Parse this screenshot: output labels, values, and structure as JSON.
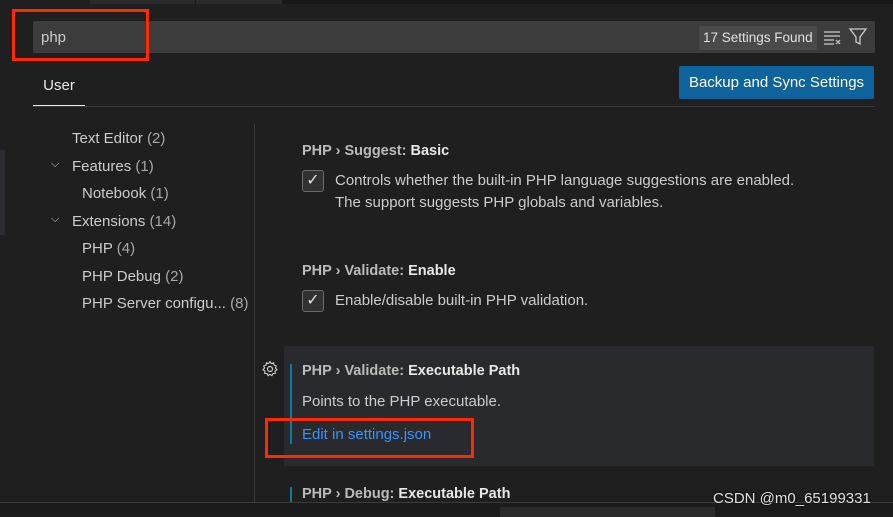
{
  "search": {
    "value": "php",
    "result_count": "17 Settings Found"
  },
  "icons": {
    "clear": "clear-filter-icon",
    "filter": "filter-icon",
    "gear": "gear-icon",
    "check": "checkmark-icon",
    "chevron": "chevron-down-icon"
  },
  "tabs": [
    {
      "label": "User",
      "active": true
    }
  ],
  "sync_button": "Backup and Sync Settings",
  "toc": [
    {
      "label": "Text Editor",
      "count": "(2)"
    },
    {
      "label": "Features",
      "count": "(1)",
      "expanded": true
    },
    {
      "label": "Notebook",
      "count": "(1)"
    },
    {
      "label": "Extensions",
      "count": "(14)",
      "expanded": true
    },
    {
      "label": "PHP",
      "count": "(4)"
    },
    {
      "label": "PHP Debug",
      "count": "(2)"
    },
    {
      "label": "PHP Server configu...",
      "count": "(8)"
    }
  ],
  "settings": [
    {
      "category": "PHP › Suggest: ",
      "name": "Basic",
      "description": "Controls whether the built-in PHP language suggestions are enabled. The support suggests PHP globals and variables.",
      "desc_line1": "Controls whether the built-in PHP language suggestions are enabled.",
      "desc_line2": "The support suggests PHP globals and variables.",
      "checked": true
    },
    {
      "category": "PHP › Validate: ",
      "name": "Enable",
      "description": "Enable/disable built-in PHP validation.",
      "checked": true
    },
    {
      "category": "PHP › Validate: ",
      "name": "Executable Path",
      "description": "Points to the PHP executable.",
      "link": "Edit in settings.json"
    },
    {
      "category": "PHP › Debug: ",
      "name": "Executable Path"
    }
  ],
  "watermark": "CSDN @m0_65199331",
  "colors": {
    "accent": "#0e639c",
    "link": "#3794ff",
    "highlight_box": "#ff2a00",
    "background": "#1f1f1f"
  }
}
